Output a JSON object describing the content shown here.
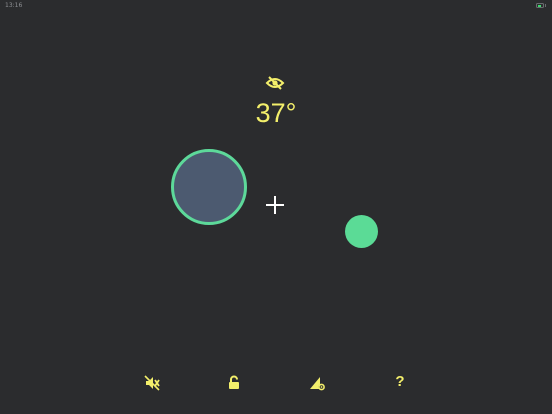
{
  "status_bar": {
    "time": "13:16",
    "battery_color": "#3ddc6e"
  },
  "display": {
    "temperature": "37°",
    "visibility_icon": "eye-off-icon"
  },
  "colors": {
    "background": "#2b2c2e",
    "accent_yellow": "#f3ef6b",
    "accent_green": "#5bdb96",
    "circle_fill": "#4c5a70"
  },
  "toolbar": {
    "mute_icon": "speaker-muted-icon",
    "lock_icon": "unlock-icon",
    "settings_icon": "ruler-gear-icon",
    "help_label": "?"
  }
}
